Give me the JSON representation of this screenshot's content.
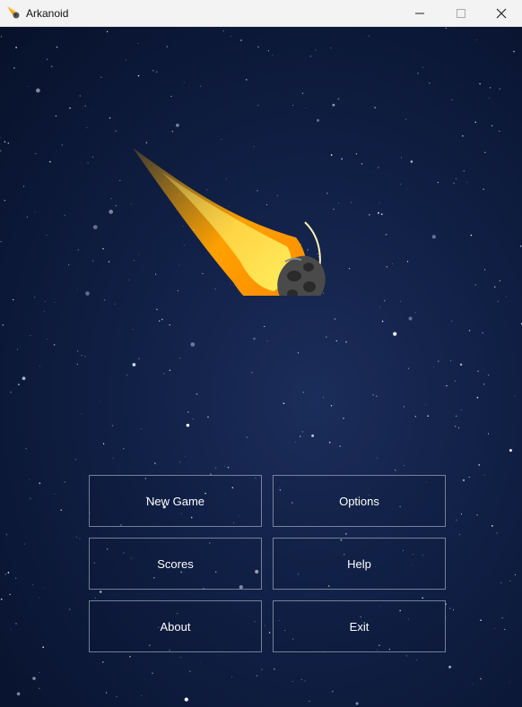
{
  "window": {
    "title": "Arkanoid"
  },
  "menu": {
    "new_game": "New Game",
    "options": "Options",
    "scores": "Scores",
    "help": "Help",
    "about": "About",
    "exit": "Exit"
  },
  "icons": {
    "app": "comet-icon",
    "minimize": "minimize-icon",
    "maximize": "maximize-icon",
    "close": "close-icon",
    "hero": "comet-illustration"
  },
  "colors": {
    "button_border": "#c8d2e6",
    "text": "#ffffff",
    "sky": "#101f44"
  }
}
